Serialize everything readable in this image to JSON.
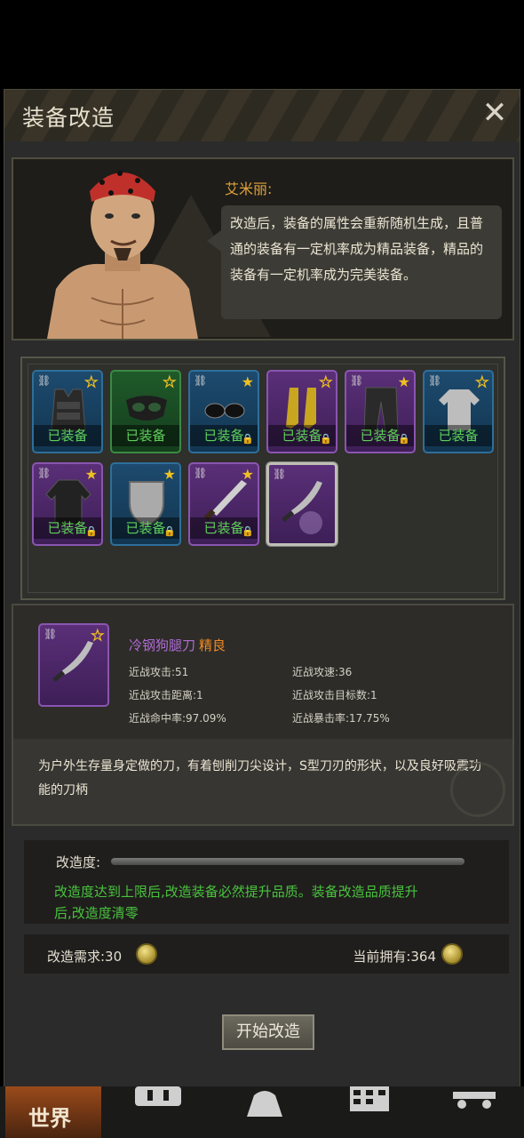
{
  "window": {
    "title": "装备改造"
  },
  "npc": {
    "name": "艾米丽:",
    "dialog": "改造后，装备的属性会重新随机生成，且普通的装备有一定机率成为精品装备，精品的装备有一定机率成为完美装备。"
  },
  "inventory": {
    "equipped_label": "已装备",
    "items": [
      {
        "name": "vest",
        "color": "blue",
        "star": "hollow",
        "equipped": true,
        "locked": false
      },
      {
        "name": "mask",
        "color": "green",
        "star": "hollow",
        "equipped": true,
        "locked": false
      },
      {
        "name": "sunglasses",
        "color": "blue",
        "star": "filled",
        "equipped": true,
        "locked": true
      },
      {
        "name": "boots",
        "color": "purple",
        "star": "hollow",
        "equipped": true,
        "locked": true
      },
      {
        "name": "pants",
        "color": "purple",
        "star": "filled",
        "equipped": true,
        "locked": true
      },
      {
        "name": "shirt",
        "color": "blue",
        "star": "hollow",
        "equipped": true,
        "locked": false
      },
      {
        "name": "jacket",
        "color": "purple",
        "star": "filled",
        "equipped": true,
        "locked": true
      },
      {
        "name": "shield",
        "color": "blue",
        "star": "filled",
        "equipped": true,
        "locked": true
      },
      {
        "name": "machete",
        "color": "purple",
        "star": "filled",
        "equipped": true,
        "locked": true
      },
      {
        "name": "kukri",
        "color": "purple",
        "star": "none",
        "equipped": false,
        "locked": false
      }
    ]
  },
  "detail": {
    "name": "冷钢狗腿刀",
    "grade": "精良",
    "stats": {
      "melee_attack": "近战攻击:51",
      "melee_speed": "近战攻速:36",
      "melee_range": "近战攻击距离:1",
      "melee_targets": "近战攻击目标数:1",
      "melee_accuracy": "近战命中率:97.09%",
      "melee_crit": "近战暴击率:17.75%"
    },
    "description": "为户外生存量身定做的刀，有着刨削刀尖设计，S型刀刃的形状，以及良好吸震功能的刀柄"
  },
  "modify": {
    "label": "改造度:",
    "progress": 0,
    "tip": "改造度达到上限后,改造装备必然提升品质。装备改造品质提升后,改造度清零"
  },
  "cost": {
    "required": "改造需求:30",
    "owned": "当前拥有:364"
  },
  "button": {
    "start": "开始改造"
  },
  "bottom_nav": {
    "world": "世界"
  }
}
